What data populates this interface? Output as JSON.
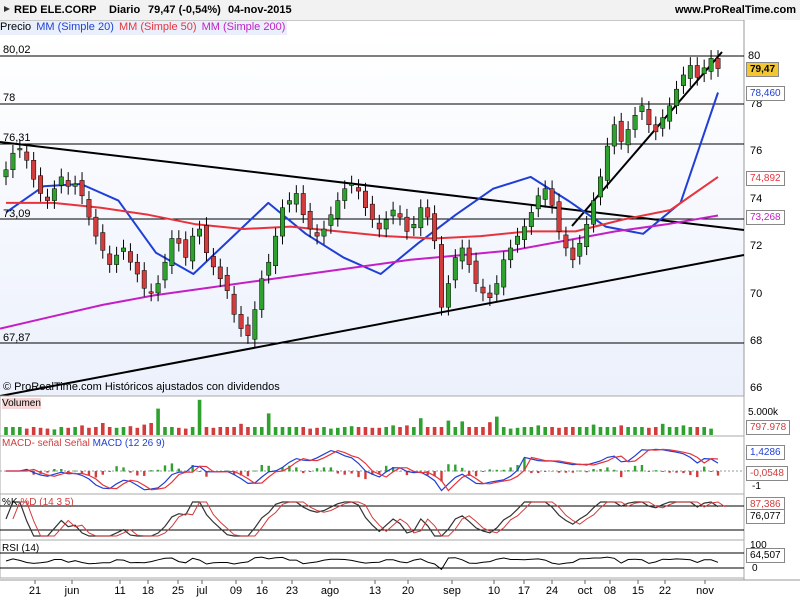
{
  "header": {
    "title": "RED ELE.CORP",
    "period": "Diario",
    "quote": "79,47 (-0,54%)",
    "date": "04-nov-2015",
    "site": "www.ProRealTime.com"
  },
  "legend": {
    "price": "Precio",
    "mm20": "MM (Simple 20)",
    "mm50": "MM (Simple 50)",
    "mm200": "MM (Simple 200)"
  },
  "colors": {
    "up": "#2ea12e",
    "down": "#d23c3c",
    "mm20": "#1f3fd6",
    "mm50": "#e8333c",
    "mm200": "#c41fc4",
    "trend": "#000000",
    "panelbg": "#e4ecfb"
  },
  "copyright": "© ProRealTime.com  Históricos ajustados con dividendos",
  "price_levels": {
    "l8002": "80,02",
    "l78": "78",
    "l7631": "76,31",
    "l7309": "73,09",
    "l6787": "67,87"
  },
  "right_axis": {
    "ticks": [
      "80",
      "78",
      "76",
      "74",
      "72",
      "70",
      "68",
      "66"
    ],
    "last_price": "79,47",
    "mm20_val": "78,460",
    "mm50_val": "74,892",
    "mm200_val": "73,268"
  },
  "volume": {
    "label": "Volumen",
    "tick": "5.000k",
    "value": "797.978"
  },
  "macd": {
    "label1": "MACD-",
    "label2": "señal",
    "label3": "Señal",
    "label4": "MACD (12 26 9)",
    "v1": "1,4286",
    "v2": "-0,0548",
    "tick": "-1"
  },
  "stoch": {
    "label1": "%K",
    "label2": "%D (14 3 5)",
    "v1": "87,386",
    "v2": "76,077"
  },
  "rsi": {
    "label": "RSI (14)",
    "tick": "100",
    "value": "64,507",
    "tick2": "0"
  },
  "x_axis": [
    "21",
    "jun",
    "11",
    "18",
    "25",
    "jul",
    "09",
    "16",
    "23",
    "ago",
    "13",
    "20",
    "sep",
    "10",
    "17",
    "24",
    "oct",
    "08",
    "15",
    "22",
    "nov"
  ],
  "chart_data": {
    "type": "candlestick",
    "title": "RED ELE.CORP Diario",
    "ylim": [
      66,
      81
    ],
    "series": [
      {
        "name": "Precio",
        "close": [
          75.2,
          75.9,
          76.1,
          75.6,
          74.8,
          74.2,
          73.9,
          74.4,
          74.9,
          74.5,
          74.6,
          74.1,
          73.2,
          72.4,
          71.8,
          71.2,
          71.6,
          71.9,
          71.3,
          70.8,
          70.2,
          70.0,
          70.4,
          71.3,
          72.3,
          72.1,
          71.5,
          72.4,
          72.7,
          71.7,
          71.1,
          70.6,
          70.1,
          69.1,
          68.5,
          68.2,
          69.3,
          70.6,
          71.3,
          72.4,
          73.6,
          73.9,
          74.2,
          73.3,
          72.7,
          72.4,
          72.7,
          73.3,
          73.9,
          74.4,
          74.6,
          74.3,
          73.6,
          73.1,
          72.7,
          73.1,
          73.5,
          73.2,
          72.6,
          72.9,
          73.6,
          73.2,
          72.2,
          69.4,
          70.4,
          71.5,
          71.9,
          71.2,
          70.4,
          70.0,
          69.8,
          70.4,
          71.4,
          71.9,
          72.4,
          72.8,
          73.4,
          74.1,
          74.4,
          73.7,
          72.6,
          71.9,
          71.4,
          72.1,
          72.9,
          73.9,
          74.9,
          76.2,
          77.1,
          76.4,
          76.9,
          77.5,
          77.9,
          77.1,
          76.8,
          77.4,
          77.9,
          78.6,
          79.2,
          79.6,
          79.1,
          79.5,
          79.9,
          79.47
        ]
      },
      {
        "name": "MM (Simple 20)",
        "values": [
          73.4,
          74.5,
          74.6,
          73.9,
          71.7,
          70.8,
          72.3,
          73.8,
          72.5,
          71.5,
          70.8,
          72.1,
          73.3,
          74.4,
          74.9,
          73.9,
          72.8,
          72.5,
          73.8,
          78.46
        ]
      },
      {
        "name": "MM (Simple 50)",
        "values": [
          73.8,
          73.8,
          73.6,
          73.3,
          72.9,
          72.7,
          72.8,
          72.6,
          72.4,
          72.3,
          72.4,
          72.6,
          72.6,
          73.1,
          73.5,
          74.9
        ]
      },
      {
        "name": "MM (Simple 200)",
        "values": [
          68.5,
          69.0,
          69.5,
          69.9,
          70.2,
          70.5,
          70.8,
          71.1,
          71.4,
          71.6,
          71.8,
          72.2,
          72.6,
          72.9,
          73.268
        ]
      }
    ],
    "volume": [
      1,
      1,
      1,
      0.8,
      1,
      0.9,
      0.8,
      0.7,
      1,
      0.9,
      1,
      1.2,
      0.9,
      1,
      1.5,
      1,
      0.9,
      1,
      1.1,
      0.9,
      1.3,
      1.5,
      3.3,
      1,
      1,
      0.9,
      0.8,
      1,
      4.4,
      1,
      0.9,
      1,
      1,
      1,
      1.4,
      1,
      1,
      1,
      2.7,
      1,
      1,
      1,
      1,
      1,
      0.8,
      0.9,
      1,
      0.8,
      0.9,
      1,
      1.1,
      1,
      1,
      0.9,
      0.9,
      1,
      1.2,
      1,
      1.2,
      1,
      2.1,
      1,
      1,
      1,
      1.8,
      1,
      1.7,
      1,
      1,
      1,
      1.6,
      2.3,
      1,
      0.8,
      0.9,
      1,
      1,
      1.2,
      1,
      1,
      0.9,
      1,
      1,
      1,
      1,
      1.3,
      1,
      1,
      1,
      1.2,
      1,
      1,
      1,
      0.9,
      1,
      1.4,
      1,
      1,
      1.2,
      1,
      1,
      1,
      0.797
    ]
  }
}
